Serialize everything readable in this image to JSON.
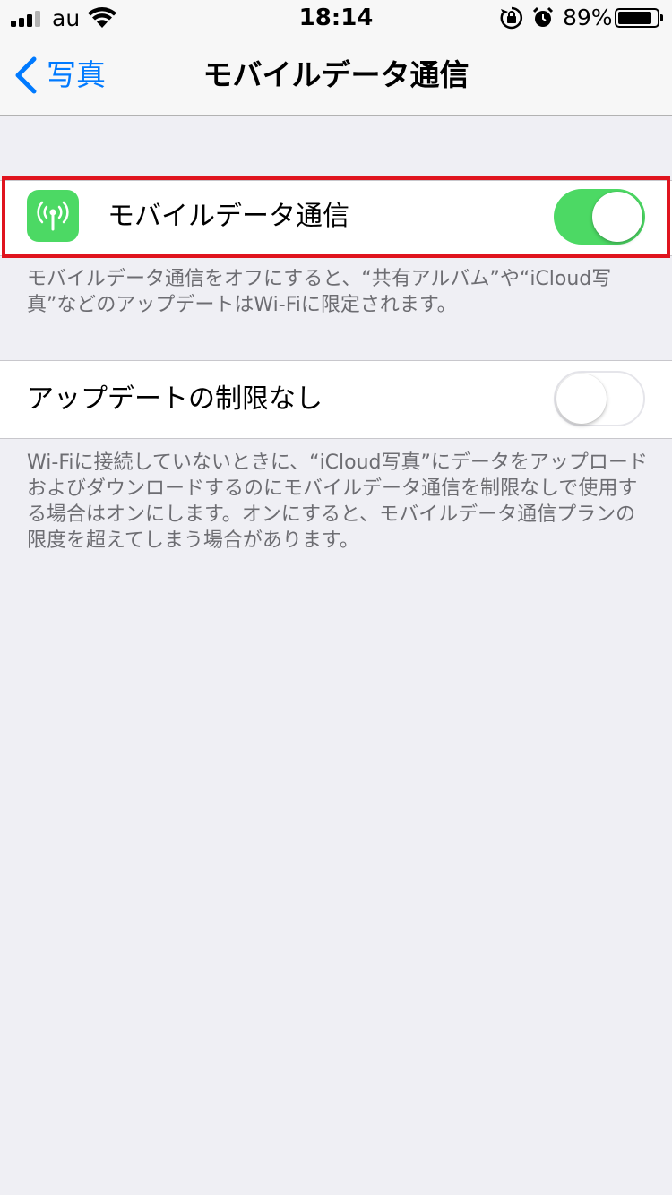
{
  "status_bar": {
    "carrier": "au",
    "time": "18:14",
    "battery_percent": "89%",
    "battery_level": 0.89,
    "signal_bars_active": 3,
    "icons": [
      "signal-icon",
      "wifi-icon",
      "rotation-lock-icon",
      "alarm-icon",
      "battery-icon"
    ]
  },
  "nav": {
    "back_label": "写真",
    "title": "モバイルデータ通信"
  },
  "settings": {
    "mobile_data": {
      "label": "モバイルデータ通信",
      "enabled": true,
      "icon": "antenna-icon",
      "footer": "モバイルデータ通信をオフにすると、“共有アルバム”や“iCloud写真”などのアップデートはWi-Fiに限定されます。"
    },
    "unlimited_updates": {
      "label": "アップデートの制限なし",
      "enabled": false,
      "footer": "Wi-Fiに接続していないときに、“iCloud写真”にデータをアップロードおよびダウンロードするのにモバイルデータ通信を制限なしで使用する場合はオンにします。オンにすると、モバイルデータ通信プランの限度を超えてしまう場合があります。"
    }
  },
  "colors": {
    "accent": "#007aff",
    "toggle_on": "#4cd964",
    "highlight": "#e0141e",
    "background": "#efeff4"
  }
}
